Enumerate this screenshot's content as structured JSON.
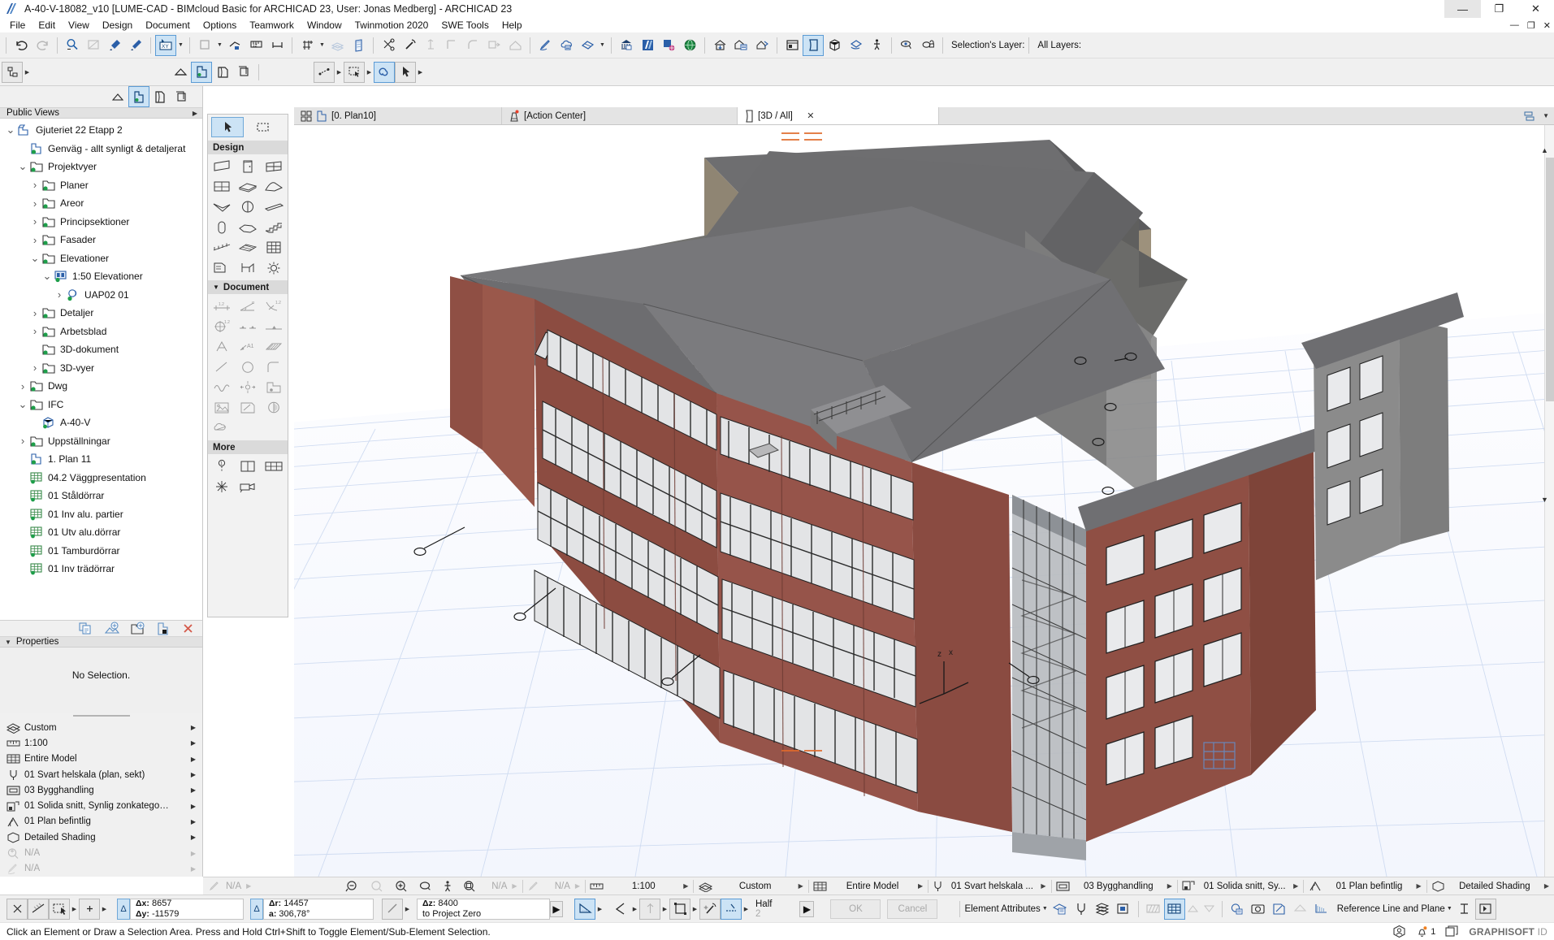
{
  "window": {
    "title": "A-40-V-18082_v10 [LUME-CAD - BIMcloud Basic for ARCHICAD 23, User: Jonas Medberg] - ARCHICAD 23",
    "minimize": "—",
    "maximize": "❐",
    "close": "✕",
    "mdi_minimize": "—",
    "mdi_restore": "❐",
    "mdi_close": "✕"
  },
  "menubar": {
    "items": [
      {
        "label": "File"
      },
      {
        "label": "Edit"
      },
      {
        "label": "View"
      },
      {
        "label": "Design"
      },
      {
        "label": "Document"
      },
      {
        "label": "Options"
      },
      {
        "label": "Teamwork"
      },
      {
        "label": "Window"
      },
      {
        "label": "Twinmotion 2020"
      },
      {
        "label": "SWE Tools"
      },
      {
        "label": "Help"
      }
    ]
  },
  "toolbar": {
    "selection_layer_label": "Selection's Layer:",
    "all_layers_label": "All Layers:",
    "icons_row1": [
      "undo-icon",
      "redo-icon",
      "find-select-icon",
      "measure-area-icon",
      "eyedropper-icon",
      "syringe-icon",
      "arrow-marquee-icon",
      "drag-copy-icon",
      "elevate-icon",
      "measure-tape-icon",
      "dimension-icon",
      "grid-snap-icon",
      "layers-icon",
      "wall-icon",
      "scissors-icon",
      "magic-wand-icon",
      "column-icon",
      "corner-icon",
      "fillet-icon",
      "stretch-icon",
      "home-icon",
      "pen-icon",
      "cloud-note-icon",
      "renovation-icon",
      "teamwork-icon",
      "archicad-doc-icon",
      "publish-icon",
      "globe-icon",
      "open-house-icon",
      "save-house-icon",
      "info-house-icon",
      "orbit-house-icon",
      "layout-icon",
      "3d-window-icon",
      "axono-icon",
      "perspective-icon",
      "walk-icon",
      "view-eye-icon",
      "lock-layer-icon"
    ],
    "icons_row2": [
      "structure-display-icon",
      "home-story-icon",
      "partial-structure-icon",
      "current-story-icon",
      "stack-icon",
      "marquee-icon",
      "select-arrow-icon",
      "pet-palette-icon",
      "arrow-tool-icon"
    ]
  },
  "navigator": {
    "panel_title": "Public Views",
    "tree": [
      {
        "label": "Gjuteriet 22 Etapp 2",
        "indent": 0,
        "twist": "down",
        "icon": "project-icon"
      },
      {
        "label": "Genväg - allt synligt & detaljerat",
        "indent": 1,
        "twist": "",
        "icon": "view-icon"
      },
      {
        "label": "Projektvyer",
        "indent": 1,
        "twist": "down",
        "icon": "folder-icon"
      },
      {
        "label": "Planer",
        "indent": 2,
        "twist": "right",
        "icon": "folder-icon"
      },
      {
        "label": "Areor",
        "indent": 2,
        "twist": "right",
        "icon": "folder-icon"
      },
      {
        "label": "Principsektioner",
        "indent": 2,
        "twist": "right",
        "icon": "folder-icon"
      },
      {
        "label": "Fasader",
        "indent": 2,
        "twist": "right",
        "icon": "folder-icon"
      },
      {
        "label": "Elevationer",
        "indent": 2,
        "twist": "down",
        "icon": "folder-icon"
      },
      {
        "label": "1:50 Elevationer",
        "indent": 3,
        "twist": "down",
        "icon": "elevation-icon"
      },
      {
        "label": "UAP02 01",
        "indent": 4,
        "twist": "right",
        "icon": "worksheet-icon"
      },
      {
        "label": "Detaljer",
        "indent": 2,
        "twist": "right",
        "icon": "folder-icon"
      },
      {
        "label": "Arbetsblad",
        "indent": 2,
        "twist": "right",
        "icon": "folder-icon"
      },
      {
        "label": "3D-dokument",
        "indent": 2,
        "twist": "",
        "icon": "folder-icon"
      },
      {
        "label": "3D-vyer",
        "indent": 2,
        "twist": "right",
        "icon": "folder-icon"
      },
      {
        "label": "Dwg",
        "indent": 1,
        "twist": "right",
        "icon": "folder-icon"
      },
      {
        "label": "IFC",
        "indent": 1,
        "twist": "down",
        "icon": "folder-icon"
      },
      {
        "label": "A-40-V",
        "indent": 2,
        "twist": "",
        "icon": "cube-icon"
      },
      {
        "label": "Uppställningar",
        "indent": 1,
        "twist": "right",
        "icon": "folder-icon"
      },
      {
        "label": "1. Plan 11",
        "indent": 1,
        "twist": "",
        "icon": "view-icon"
      },
      {
        "label": "04.2 Väggpresentation",
        "indent": 1,
        "twist": "",
        "icon": "schedule-icon"
      },
      {
        "label": "01 Ståldörrar",
        "indent": 1,
        "twist": "",
        "icon": "schedule-icon"
      },
      {
        "label": "01 Inv alu. partier",
        "indent": 1,
        "twist": "",
        "icon": "schedule-icon"
      },
      {
        "label": "01 Utv alu.dörrar",
        "indent": 1,
        "twist": "",
        "icon": "schedule-icon"
      },
      {
        "label": "01 Tamburdörrar",
        "indent": 1,
        "twist": "",
        "icon": "schedule-icon"
      },
      {
        "label": "01 Inv trädörrar",
        "indent": 1,
        "twist": "",
        "icon": "schedule-icon"
      }
    ],
    "buttons": [
      "clone-folder-icon",
      "new-view-icon",
      "new-folder-icon",
      "save-view-icon",
      "delete-icon"
    ]
  },
  "properties": {
    "title": "Properties",
    "empty_text": "No Selection."
  },
  "quick_options": {
    "rows": [
      {
        "label": "Custom",
        "icon": "layer-combination-icon",
        "disabled": false
      },
      {
        "label": "1:100",
        "icon": "scale-icon",
        "disabled": false
      },
      {
        "label": "Entire Model",
        "icon": "structure-icon",
        "disabled": false
      },
      {
        "label": "01 Svart helskala (plan, sekt)",
        "icon": "pen-set-icon",
        "disabled": false
      },
      {
        "label": "03 Bygghandling",
        "icon": "model-view-icon",
        "disabled": false
      },
      {
        "label": "01 Solida snitt, Synlig zonkategorifärg ...",
        "icon": "graphic-override-icon",
        "disabled": false
      },
      {
        "label": "01 Plan befintlig",
        "icon": "renovation-filter-icon",
        "disabled": false
      },
      {
        "label": "Detailed Shading",
        "icon": "3d-style-icon",
        "disabled": false
      },
      {
        "label": "N/A",
        "icon": "zoom-icon",
        "disabled": true
      },
      {
        "label": "N/A",
        "icon": "dimension-style-icon",
        "disabled": true
      }
    ]
  },
  "toolbox": {
    "arrow_tool": "arrow-tool-icon",
    "marquee_tool": "marquee-tool-icon",
    "sections": [
      {
        "title": "Design",
        "collapsed": false,
        "tools": [
          "wall-icon",
          "door-icon",
          "window-icon",
          "curtain-wall-icon",
          "slab-icon",
          "roof-icon",
          "shell-icon",
          "morph-icon",
          "beam-icon",
          "column-icon",
          "mesh-icon",
          "stair-icon",
          "railing-icon",
          "mesh-surface-icon",
          "zone-icon",
          "object-icon",
          "furniture-icon",
          "lamp-icon"
        ]
      },
      {
        "title": "Document",
        "collapsed": false,
        "tools": [
          "dimension-icon",
          "angle-dimension-icon",
          "radial-dimension-icon",
          "level-dimension-icon",
          "elevation-dim-icon",
          "spot-level-icon",
          "text-icon",
          "label-icon",
          "fill-icon",
          "line-icon",
          "circle-icon",
          "polyline-icon",
          "spline-icon",
          "hotspot-icon",
          "figure-icon",
          "picture-icon",
          "drawing-icon",
          "section-icon",
          "change-icon"
        ]
      },
      {
        "title": "More",
        "collapsed": false,
        "tools": [
          "section-marker-icon",
          "elevation-marker-icon",
          "interior-elevation-icon",
          "detail-icon",
          "camera-icon"
        ]
      }
    ]
  },
  "tabs": [
    {
      "label": "[0. Plan10]",
      "icon": "floorplan-icon",
      "active": false,
      "closable": false
    },
    {
      "label": "[Action Center]",
      "icon": "action-center-icon",
      "active": false,
      "closable": false
    },
    {
      "label": "[3D / All]",
      "icon": "3d-view-icon",
      "active": true,
      "closable": true,
      "close": "✕"
    }
  ],
  "viewbar": {
    "left_items": [
      {
        "label": "N/A",
        "icon": "pen-weight-icon",
        "disabled": true
      },
      {
        "label": "",
        "icon": "zoom-out-icon",
        "disabled": false
      },
      {
        "label": "",
        "icon": "zoom-prev-icon",
        "disabled": true
      },
      {
        "label": "",
        "icon": "zoom-in-icon",
        "disabled": false
      },
      {
        "label": "",
        "icon": "orbit-icon",
        "disabled": false
      },
      {
        "label": "",
        "icon": "explore-icon",
        "disabled": false
      },
      {
        "label": "",
        "icon": "fit-in-window-icon",
        "disabled": false
      },
      {
        "label": "N/A",
        "icon": "",
        "disabled": true
      },
      {
        "label": "",
        "icon": "refresh-icon",
        "disabled": true
      },
      {
        "label": "N/A",
        "icon": "",
        "disabled": true
      }
    ],
    "right_items": [
      {
        "label": "1:100",
        "icon": "scale-icon"
      },
      {
        "label": "Custom",
        "icon": "layer-combination-icon"
      },
      {
        "label": "Entire Model",
        "icon": "structure-icon"
      },
      {
        "label": "01 Svart helskala ...",
        "icon": "pen-set-icon"
      },
      {
        "label": "03 Bygghandling",
        "icon": "model-view-icon"
      },
      {
        "label": "01 Solida snitt, Sy...",
        "icon": "graphic-override-icon"
      },
      {
        "label": "01 Plan befintlig",
        "icon": "renovation-filter-icon"
      },
      {
        "label": "Detailed Shading",
        "icon": "3d-style-icon"
      }
    ]
  },
  "infobox": {
    "coord_x_label": "Δx:",
    "coord_x_value": "8657",
    "coord_y_label": "Δy:",
    "coord_y_value": "-11579",
    "coord_r_label": "Δr:",
    "coord_r_value": "14457",
    "coord_a_label": "a:",
    "coord_a_value": "306,78°",
    "coord_z_label": "Δz:",
    "coord_z_value": "8400",
    "coord_z_ref": "to Project Zero",
    "half_label": "Half",
    "half_value": "2",
    "ok_label": "OK",
    "cancel_label": "Cancel",
    "element_attributes_label": "Element Attributes",
    "reference_label": "Reference Line and Plane"
  },
  "statusbar": {
    "message": "Click an Element or Draw a Selection Area. Press and Hold Ctrl+Shift to Toggle Element/Sub-Element Selection.",
    "notification_count": "1",
    "graphisoft_id_prefix": "GRAPHISOFT",
    "graphisoft_id_suffix": " ID"
  },
  "colors": {
    "accent_blue": "#cce3f5",
    "accent_border": "#6fa8d8",
    "panel_bg": "#f0f0f0",
    "header_bg": "#e2e2e2",
    "brick_red": "#8c4a40",
    "roof_gray": "#6e6e70",
    "stucco_tan": "#9a8f7b",
    "ground_grid": "#c8d4ea",
    "tree_green": "#1e9e4a",
    "icon_blue": "#1f5fa9"
  },
  "viewport": {
    "model_name": "3D / All",
    "grid_color": "#ccd8ef"
  }
}
